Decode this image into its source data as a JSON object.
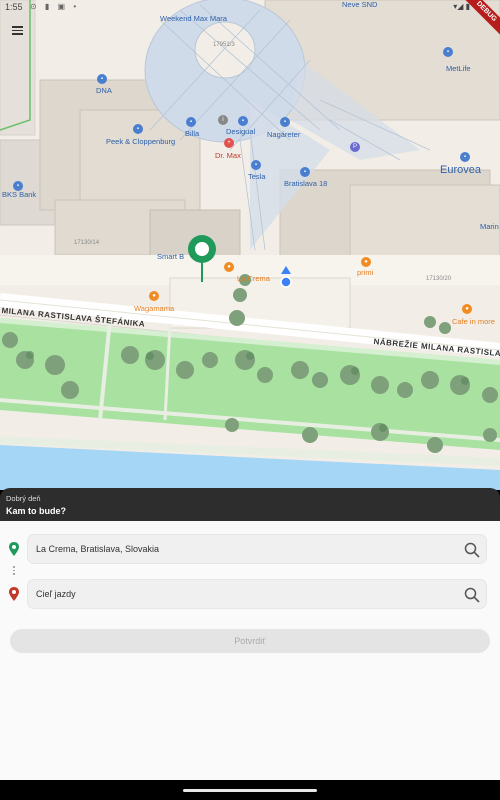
{
  "status_bar": {
    "time": "1:55",
    "icons": "⊙ ▮ ▣ •",
    "right": "▾◢ ▮"
  },
  "debug_label": "DEBUG",
  "map": {
    "labels": {
      "weekend_max_mara": "Weekend Max Mara",
      "neve_snd": "Neve SND",
      "metlife": "MetLife",
      "dna": "DNA",
      "desigual": "Desigual",
      "peek": "Peek & Cloppenburg",
      "billa": "Billa",
      "dr_max": "Dr. Max",
      "nagareter": "Nagáreter",
      "tesla": "Tesla",
      "bratislava18": "Bratislava 18",
      "eurovea": "Eurovea",
      "bks_bank": "BKS Bank",
      "marino": "Marin",
      "smart": "Smart B",
      "la_crema": "La Crema",
      "primi": "primi",
      "wagamama": "Wagamama",
      "cafe": "Cafe in more",
      "street1": "MILANA RASTISLAVA ŠTEFÁNIKA",
      "street2": "NÁBREŽIE MILANA RASTISLAVA",
      "num1": "17951/3",
      "num2": "17130/14",
      "num3": "17130/20"
    }
  },
  "sheet": {
    "greeting": "Dobrý deň",
    "question": "Kam to bude?"
  },
  "form": {
    "origin_value": "La Crema, Bratislava, Slovakia",
    "destination_placeholder": "Cieľ jazdy",
    "confirm_label": "Potvrdiť"
  },
  "colors": {
    "origin_marker": "#1f9a5a",
    "destination_marker": "#c0392b",
    "sheet_header": "#2d2d2d",
    "park_green": "#a8e1a0",
    "river_blue": "#a6d6f5"
  },
  "icons": {
    "menu": "menu-icon",
    "search": "search-icon",
    "origin_marker": "green-pin-icon",
    "destination_marker": "red-pin-icon"
  }
}
